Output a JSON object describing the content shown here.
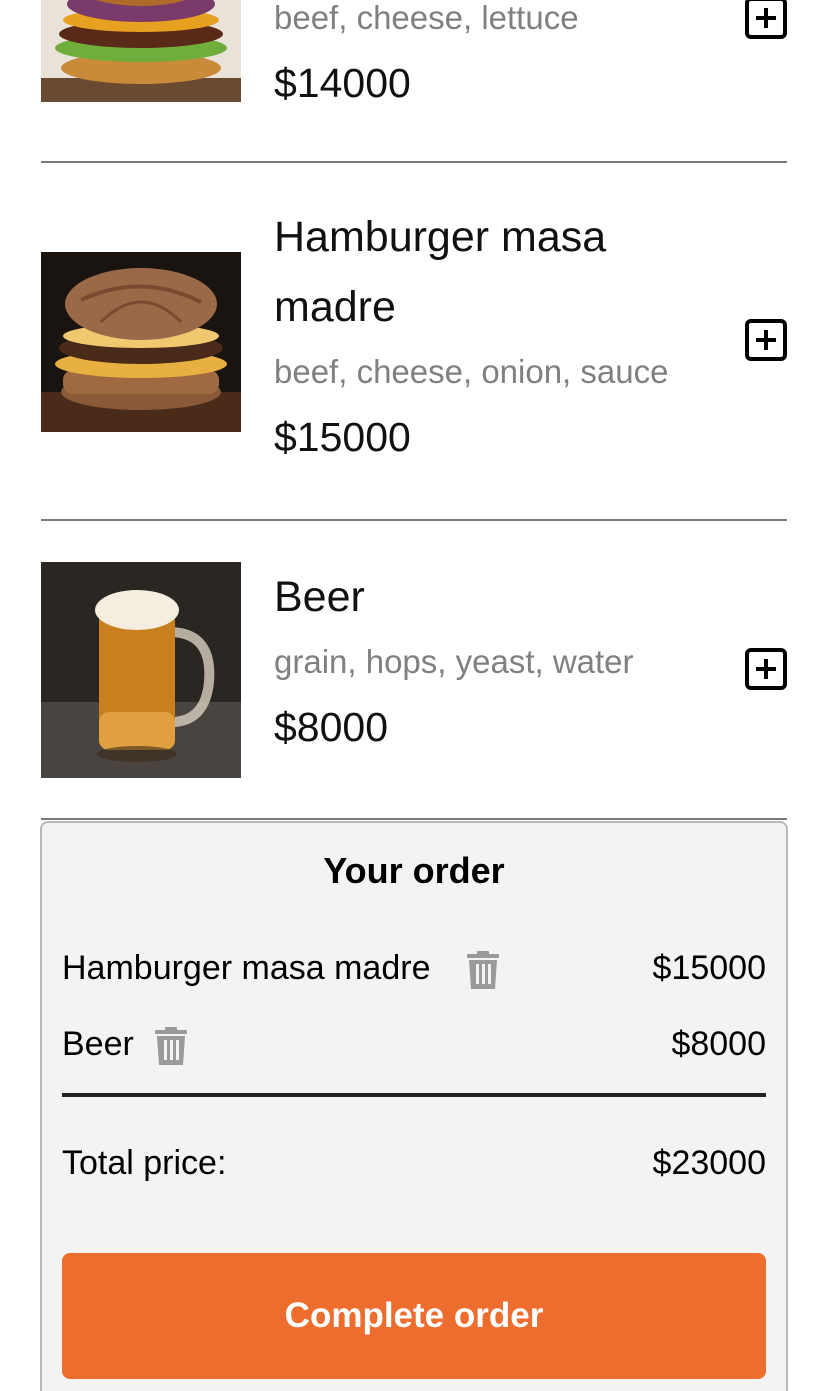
{
  "menu": {
    "items": [
      {
        "name": "",
        "ingredients": "beef, cheese, lettuce",
        "price": "$14000",
        "image": "burger-lettuce-photo"
      },
      {
        "name": "Hamburger masa madre",
        "ingredients": "beef, cheese, onion, sauce",
        "price": "$15000",
        "image": "burger-masa-madre-photo"
      },
      {
        "name": "Beer",
        "ingredients": "grain, hops, yeast, water",
        "price": "$8000",
        "image": "beer-mug-photo"
      }
    ],
    "add_icon": "plus-square-icon"
  },
  "order": {
    "title": "Your order",
    "lines": [
      {
        "name": "Hamburger masa madre",
        "price": "$15000"
      },
      {
        "name": "Beer",
        "price": "$8000"
      }
    ],
    "remove_icon": "trash-icon",
    "total_label": "Total price:",
    "total_value": "$23000",
    "complete_label": "Complete order"
  },
  "colors": {
    "accent": "#ec6d2e",
    "muted_text": "#808080",
    "panel_bg": "#f3f3f3"
  }
}
